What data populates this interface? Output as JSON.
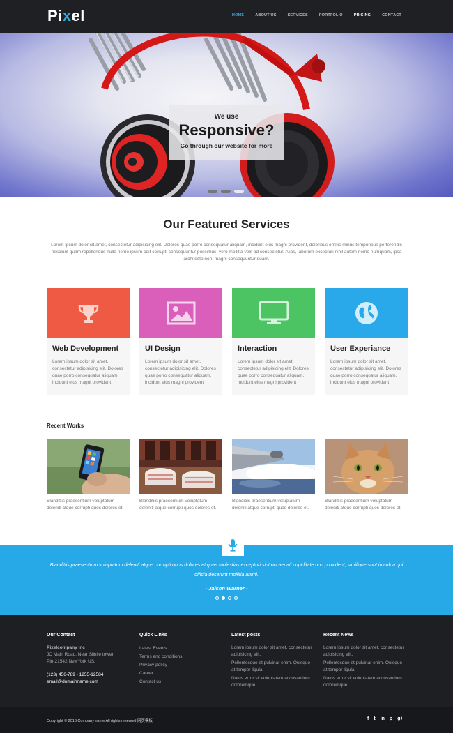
{
  "header": {
    "logo_left": "Pi",
    "logo_x": "x",
    "logo_right": "el",
    "nav": [
      "HOME",
      "ABOUT US",
      "SERVICES",
      "PORTFOLIO",
      "PRICING",
      "CONTACT"
    ]
  },
  "hero": {
    "line1": "We use",
    "line2": "Responsive?",
    "line3": "Go through our website for more"
  },
  "services": {
    "title": "Our Featured Services",
    "intro": "Lorem ipsum dolor sit amet, consectetur adipisicing elit. Dolores quae porro consequatur aliquam, incidunt eius magni provident, doloribus omnis minus temporibus perferendis nesciunt quam repellendus nulla nemo ipsum odit corrupti consequuntur possimus, vero mollitia velit ad consectetur. Alias, laborum excepturi nihil autem nemo numquam, ipsa architecto non, magni consequuntur quam.",
    "cards": [
      {
        "title": "Web Development",
        "text": "Lorem ipsum dolor sit amet, consectetur adipisicing elit. Dolores quae porro consequatur aliquam, incidunt eius magni provident",
        "color": "#ee5a43",
        "icon": "trophy-icon"
      },
      {
        "title": "UI Design",
        "text": "Lorem ipsum dolor sit amet, consectetur adipisicing elit. Dolores quae porro consequatur aliquam, incidunt eius magni provident",
        "color": "#d95fba",
        "icon": "picture-icon"
      },
      {
        "title": "Interaction",
        "text": "Lorem ipsum dolor sit amet, consectetur adipisicing elit. Dolores quae porro consequatur aliquam, incidunt eius magni provident",
        "color": "#4cc464",
        "icon": "monitor-icon"
      },
      {
        "title": "User Experiance",
        "text": "Lorem ipsum dolor sit amet, consectetur adipisicing elit. Dolores quae porro consequatur aliquam, incidunt eius magni provident",
        "color": "#29a9ea",
        "icon": "globe-icon"
      }
    ]
  },
  "works": {
    "title": "Recent Works",
    "items": [
      {
        "caption": "Blanditiis praesentium voluptatum deleniti atque corrupti quos dolores et."
      },
      {
        "caption": "Blanditiis praesentium voluptatum deleniti atque corrupti quos dolores et."
      },
      {
        "caption": "Blanditiis praesentium voluptatum deleniti atque corrupti quos dolores et."
      },
      {
        "caption": "Blanditiis praesentium voluptatum deleniti atque corrupti quos dolores et."
      }
    ]
  },
  "testimonial": {
    "quote": "Blanditiis praesentium voluptatum deleniti atque corrupti quos dolores et quas molestias excepturi sint occaecati cupiditate non provident, similique sunt in culpa qui officia deserunt mollitia animi.",
    "author": "- Jaison Warner -"
  },
  "footer": {
    "contact": {
      "title": "Our Contact",
      "company": "Pixelcompany Inc",
      "address1": "JC Main Road, Near Silnile tower",
      "address2": "Pin-21542 NewYork US.",
      "phone": "(123) 456-789 - 1255-12584",
      "email": "email@domainname.com"
    },
    "links": {
      "title": "Quick Links",
      "items": [
        "Latest Events",
        "Terms and conditions",
        "Privacy policy",
        "Career",
        "Contact us"
      ]
    },
    "posts": {
      "title": "Latest posts",
      "items": [
        "Lorem ipsum dolor sit amet, consectetur adipisicing elit.",
        "Pellentesque et pulvinar enim. Quisque at tempor ligula",
        "Natus error sit voluptatem accusantium doloremque"
      ]
    },
    "news": {
      "title": "Recent News",
      "items": [
        "Lorem ipsum dolor sit amet, consectetur adipisicing elit.",
        "Pellentesque et pulvinar enim. Quisque at tempor ligula",
        "Natus error sit voluptatem accusantium doloremque"
      ]
    },
    "copyright": "Copyright © 2016.Company name All rights reserved.网页模板",
    "social": [
      "f",
      "t",
      "in",
      "p",
      "g+"
    ]
  }
}
